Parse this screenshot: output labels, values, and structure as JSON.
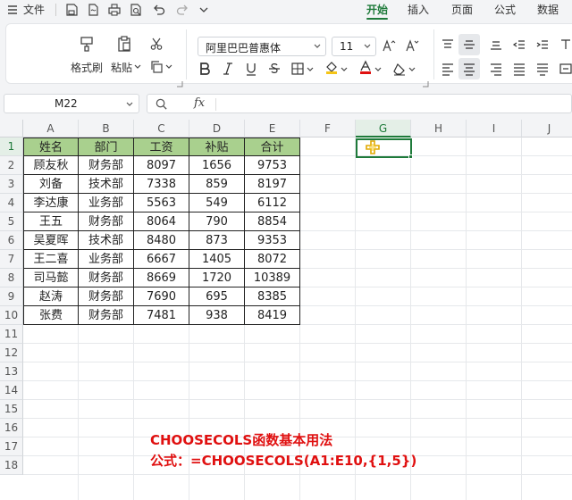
{
  "menubar": {
    "file_label": "文件",
    "tabs": [
      "开始",
      "插入",
      "页面",
      "公式",
      "数据"
    ]
  },
  "ribbon": {
    "format_painter_label": "格式刷",
    "paste_label": "粘贴",
    "font_name": "阿里巴巴普惠体",
    "font_size": "11"
  },
  "formula_bar": {
    "name_box": "M22",
    "fx_label": "fx",
    "formula": ""
  },
  "grid": {
    "columns": [
      "A",
      "B",
      "C",
      "D",
      "E",
      "F",
      "G",
      "H",
      "I",
      "J"
    ],
    "rows": [
      "1",
      "2",
      "3",
      "4",
      "5",
      "6",
      "7",
      "8",
      "9",
      "10",
      "11",
      "12",
      "13",
      "14",
      "15",
      "16",
      "17",
      "18"
    ],
    "selected_column": "G",
    "selected_row": "1"
  },
  "table": {
    "headers": [
      "姓名",
      "部门",
      "工资",
      "补贴",
      "合计"
    ],
    "rows": [
      [
        "顾友秋",
        "财务部",
        "8097",
        "1656",
        "9753"
      ],
      [
        "刘备",
        "技术部",
        "7338",
        "859",
        "8197"
      ],
      [
        "李达康",
        "业务部",
        "5563",
        "549",
        "6112"
      ],
      [
        "王五",
        "财务部",
        "8064",
        "790",
        "8854"
      ],
      [
        "吴夏晖",
        "技术部",
        "8480",
        "873",
        "9353"
      ],
      [
        "王二喜",
        "业务部",
        "6667",
        "1405",
        "8072"
      ],
      [
        "司马懿",
        "财务部",
        "8669",
        "1720",
        "10389"
      ],
      [
        "赵涛",
        "财务部",
        "7690",
        "695",
        "8385"
      ],
      [
        "张费",
        "财务部",
        "7481",
        "938",
        "8419"
      ]
    ],
    "header_color": "#a9d08e"
  },
  "notes": {
    "line1": "CHOOSECOLS函数基本用法",
    "line2": "公式：=CHOOSECOLS(A1:E10,{1,5})",
    "color": "#e01010"
  }
}
